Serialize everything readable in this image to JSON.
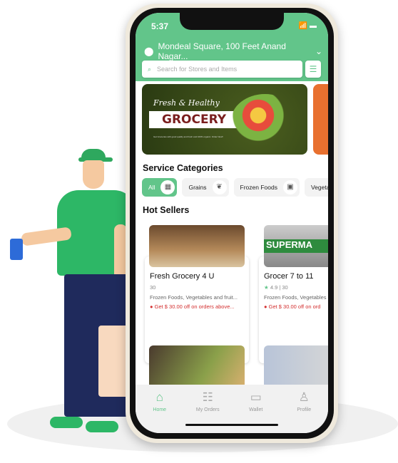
{
  "status": {
    "time": "5:37"
  },
  "header": {
    "location": "Mondeal Square, 100 Feet Anand Nagar...",
    "search_placeholder": "Search for Stores and Items"
  },
  "banner": {
    "script": "Fresh & Healthy",
    "title": "GROCERY",
    "sub": "Get Groceries with good quality and fresh and 100% organic. Order Now!!"
  },
  "categories": {
    "title": "Service Categories",
    "items": [
      {
        "label": "All",
        "icon": "basket-icon",
        "active": true
      },
      {
        "label": "Grains",
        "icon": "grain-icon"
      },
      {
        "label": "Frozen Foods",
        "icon": "frozen-icon"
      },
      {
        "label": "Vegetab"
      }
    ]
  },
  "hot": {
    "title": "Hot Sellers",
    "cards": [
      {
        "name": "Fresh Grocery 4 U",
        "rating": "",
        "time": "30",
        "desc": "Frozen Foods, Vegetables and fruit...",
        "offer": "Get $ 30.00 off on orders above..."
      },
      {
        "name": "Grocer 7 to 11",
        "rating": "4.9",
        "time": "30",
        "desc": "Frozen Foods, Vegetables",
        "offer": "Get $ 30.00 off on ord",
        "banner": "SUPERMA"
      }
    ]
  },
  "nav": [
    {
      "label": "Home",
      "icon": "home-icon",
      "active": true
    },
    {
      "label": "My Orders",
      "icon": "orders-icon"
    },
    {
      "label": "Wallet",
      "icon": "wallet-icon"
    },
    {
      "label": "Profile",
      "icon": "profile-icon"
    }
  ],
  "colors": {
    "accent": "#62c58a",
    "offer": "#d32f2f"
  }
}
